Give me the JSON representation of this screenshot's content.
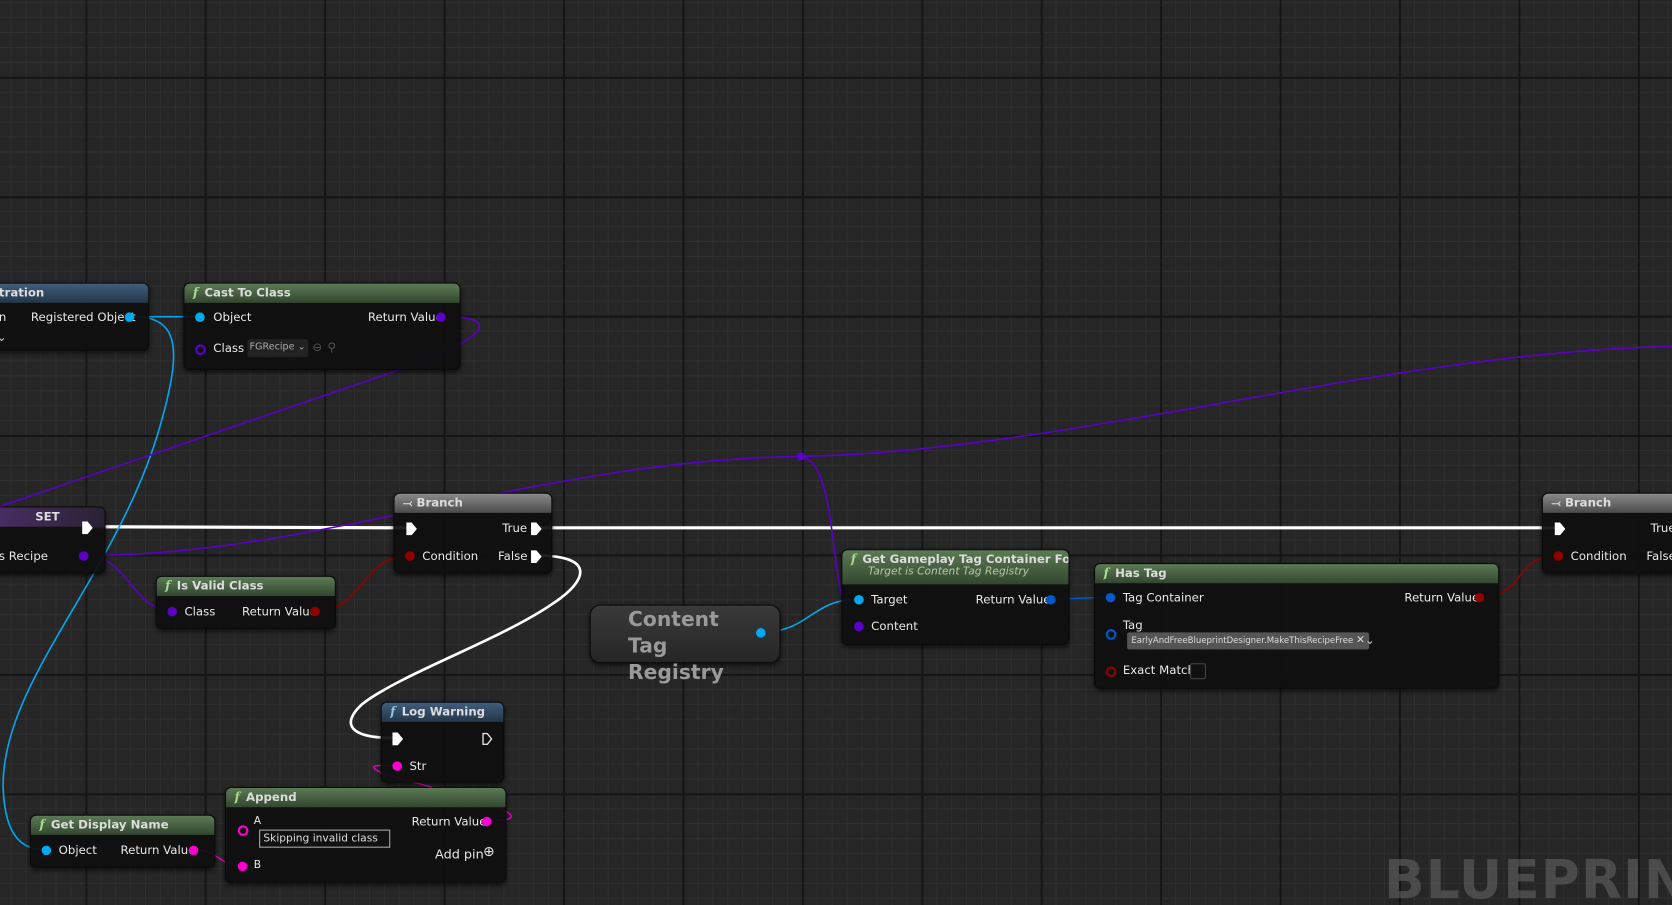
{
  "nodes": {
    "registration": {
      "title": "tration",
      "left_label": "n",
      "pin": "Registered Object"
    },
    "cast": {
      "title": "Cast To Class",
      "object": "Object",
      "return": "Return Value",
      "class": "Class",
      "class_value": "FGRecipe"
    },
    "set": {
      "title": "SET",
      "pin": "s Recipe"
    },
    "branch1": {
      "title": "Branch",
      "true": "True",
      "false": "False",
      "condition": "Condition"
    },
    "is_valid": {
      "title": "Is Valid Class",
      "class": "Class",
      "return": "Return Value"
    },
    "registry": {
      "title": "Content Tag Registry"
    },
    "get_tags": {
      "title": "Get Gameplay Tag Container For",
      "subtitle": "Target is Content Tag Registry",
      "target": "Target",
      "content": "Content",
      "return": "Return Value"
    },
    "has_tag": {
      "title": "Has Tag",
      "tag_container": "Tag Container",
      "return": "Return Value",
      "tag": "Tag",
      "tag_value": "EarlyAndFreeBlueprintDesigner.MakeThisRecipeFree",
      "exact_match": "Exact Match"
    },
    "branch2": {
      "title": "Branch",
      "true": "True",
      "false": "False",
      "condition": "Condition"
    },
    "log_warning": {
      "title": "Log Warning",
      "str": "Str"
    },
    "append": {
      "title": "Append",
      "a": "A",
      "a_value": "Skipping invalid class",
      "b": "B",
      "return": "Return Value",
      "add_pin": "Add pin"
    },
    "display_name": {
      "title": "Get Display Name",
      "object": "Object",
      "return": "Return Value"
    }
  },
  "watermark": "BLUEPRINT",
  "colors": {
    "exec": "#ffffff",
    "object": "#00a8f2",
    "class": "#5b00c8",
    "bool": "#920101",
    "string": "#fb00d1",
    "struct": "#0059cb"
  }
}
